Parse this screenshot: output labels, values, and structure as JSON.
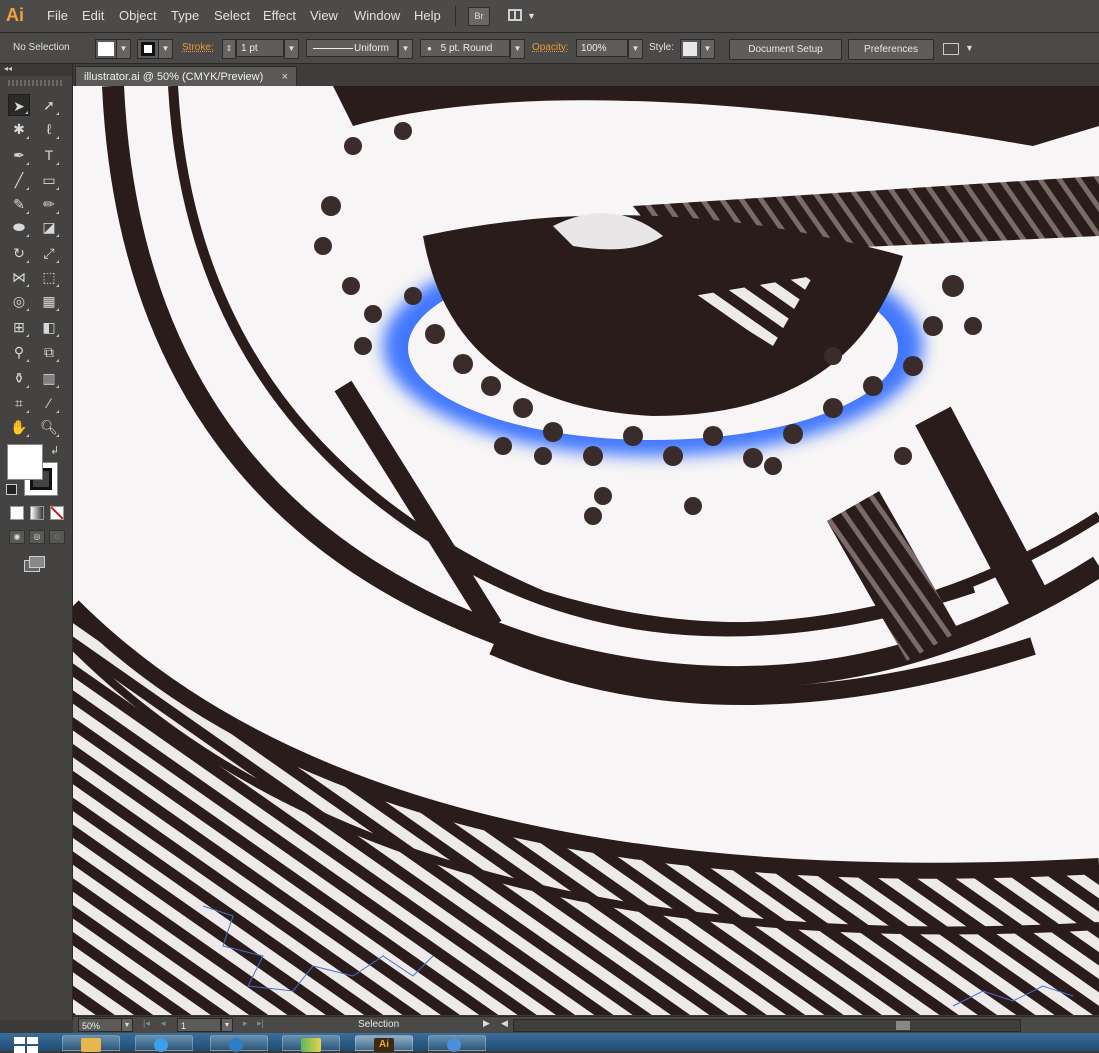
{
  "app": {
    "logo": "Ai"
  },
  "menu": [
    "File",
    "Edit",
    "Object",
    "Type",
    "Select",
    "Effect",
    "View",
    "Window",
    "Help"
  ],
  "bridge_label": "Br",
  "control": {
    "selection": "No Selection",
    "stroke_label": "Stroke:",
    "stroke_weight": "1 pt",
    "profile": "Uniform",
    "brush": "5 pt. Round",
    "opacity_label": "Opacity:",
    "opacity": "100%",
    "style_label": "Style:",
    "document_setup": "Document Setup",
    "preferences": "Preferences"
  },
  "document": {
    "tab_title": "illustrator.ai @ 50% (CMYK/Preview)",
    "close": "×"
  },
  "status": {
    "zoom": "50%",
    "artboard": "1",
    "tool": "Selection"
  },
  "colors": {
    "accent": "#f0a33a",
    "glow": "#2f6bff",
    "ink": "#2a1c1b"
  }
}
